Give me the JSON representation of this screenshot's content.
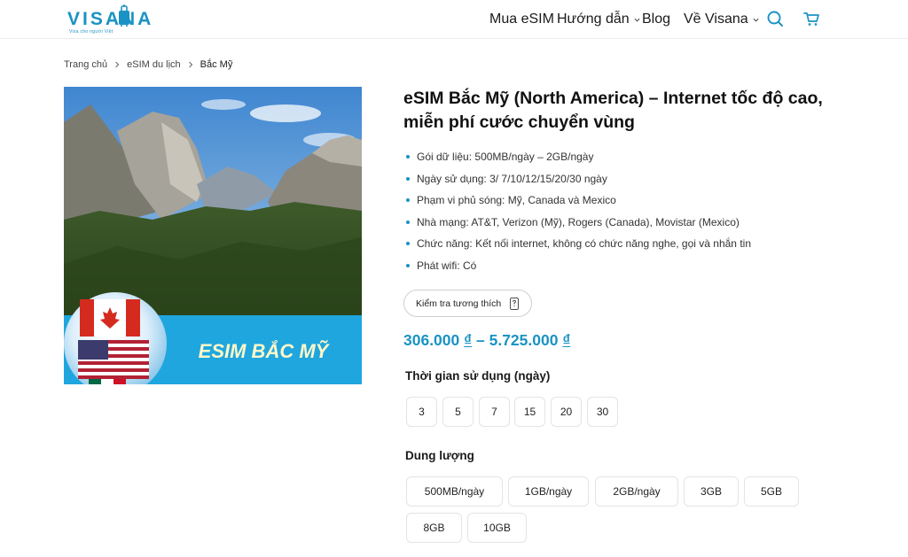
{
  "header": {
    "logo": {
      "text": "VISANA",
      "tagline": "Visa cho người Việt"
    },
    "nav": [
      {
        "label": "Mua eSIM"
      },
      {
        "label": "Hướng dẫn"
      },
      {
        "label": "Blog"
      },
      {
        "label": "Về Visana"
      }
    ],
    "icons": [
      "search-icon",
      "cart-icon"
    ]
  },
  "breadcrumb": [
    "Trang chủ",
    "eSIM du lịch",
    "Bắc Mỹ"
  ],
  "product": {
    "image_banner_text": "ESIM BẮC MỸ",
    "title": "eSIM Bắc Mỹ (North America) – Internet tốc độ cao, miễn phí cước chuyển vùng",
    "features": [
      "Gói dữ liệu: 500MB/ngày – 2GB/ngày",
      "Ngày sử dụng: 3/ 7/10/12/15/20/30 ngày",
      "Phạm vi phủ sóng: Mỹ, Canada và Mexico",
      "Nhà mạng: AT&T, Verizon (Mỹ), Rogers (Canada), Movistar (Mexico)",
      "Chức năng: Kết nối internet, không có chức năng nghe, gọi và nhắn tin",
      "Phát wifi: Có"
    ],
    "compat_button": "Kiểm tra tương thích",
    "price_min": "306.000",
    "price_dash": " – ",
    "price_max": "5.725.000",
    "currency": "₫",
    "duration_label": "Thời gian sử dụng (ngày)",
    "durations": [
      "3",
      "5",
      "7",
      "15",
      "20",
      "30"
    ],
    "capacity_label": "Dung lượng",
    "capacities": [
      "500MB/ngày",
      "1GB/ngày",
      "2GB/ngày",
      "3GB",
      "5GB",
      "8GB",
      "10GB"
    ]
  },
  "colors": {
    "accent": "#1a93c4",
    "banner": "#1fa6df"
  }
}
